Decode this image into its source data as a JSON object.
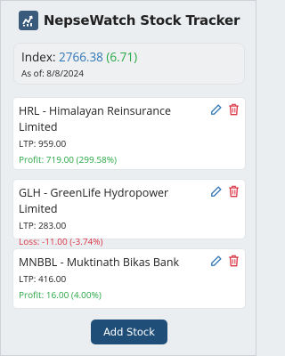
{
  "app": {
    "title": "NepseWatch Stock Tracker"
  },
  "index": {
    "label": "Index:",
    "value": "2766.38",
    "change": "(6.71)",
    "as_of": "As of: 8/8/2024"
  },
  "stocks": [
    {
      "name": "HRL - Himalayan Reinsurance Limited",
      "ltp": "LTP: 959.00",
      "pl": "Profit: 719.00 (299.58%)",
      "pl_type": "profit"
    },
    {
      "name": "GLH - GreenLife Hydropower Limited",
      "ltp": "LTP: 283.00",
      "pl": "Loss: -11.00 (-3.74%)",
      "pl_type": "loss"
    },
    {
      "name": "MNBBL - Muktinath Bikas Bank",
      "ltp": "LTP: 416.00",
      "pl": "Profit: 16.00 (4.00%)",
      "pl_type": "profit"
    }
  ],
  "actions": {
    "add_label": "Add Stock"
  },
  "icons": {
    "logo": "chart-trend-icon",
    "edit": "edit-icon",
    "delete": "trash-icon"
  },
  "colors": {
    "accent": "#1f4e79",
    "index_value": "#2e75b6",
    "profit": "#28a745",
    "loss": "#dc3545",
    "edit_icon": "#2e75b6",
    "delete_icon": "#dc3545"
  }
}
